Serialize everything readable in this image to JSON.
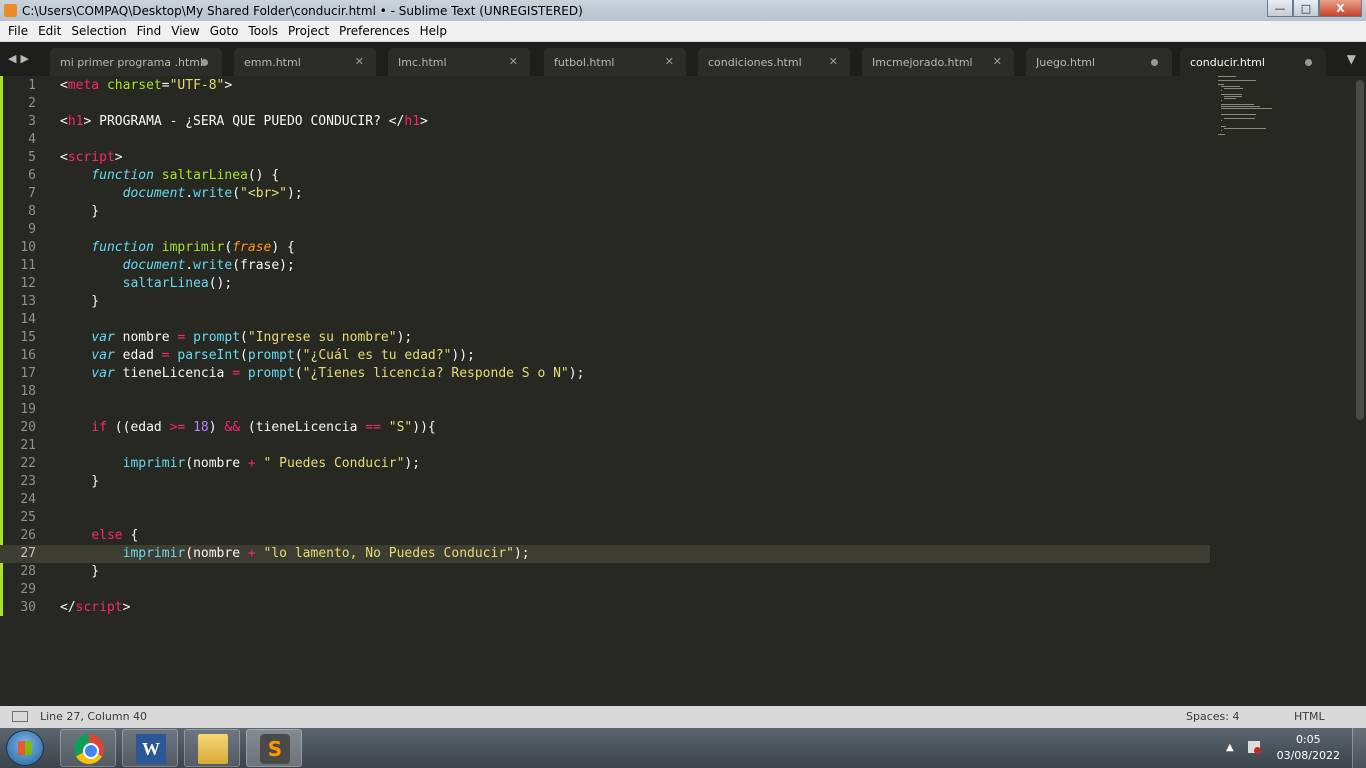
{
  "window": {
    "title": "C:\\Users\\COMPAQ\\Desktop\\My Shared Folder\\conducir.html • - Sublime Text (UNREGISTERED)",
    "minimize": "—",
    "maximize": "□",
    "close": "X"
  },
  "menu": [
    "File",
    "Edit",
    "Selection",
    "Find",
    "View",
    "Goto",
    "Tools",
    "Project",
    "Preferences",
    "Help"
  ],
  "tabs": [
    {
      "label": "mi primer programa .html",
      "state": "modified"
    },
    {
      "label": "emm.html",
      "state": "close"
    },
    {
      "label": "Imc.html",
      "state": "close"
    },
    {
      "label": "futbol.html",
      "state": "close"
    },
    {
      "label": "condiciones.html",
      "state": "close"
    },
    {
      "label": "Imcmejorado.html",
      "state": "close"
    },
    {
      "label": "Juego.html",
      "state": "modified"
    },
    {
      "label": "conducir.html",
      "state": "modified",
      "active": true
    }
  ],
  "editor": {
    "current_line": 27,
    "lines": [
      [
        [
          "w",
          "<"
        ],
        [
          "k",
          "meta"
        ],
        [
          "w",
          " "
        ],
        [
          "a",
          "charset"
        ],
        [
          "w",
          "="
        ],
        [
          "s",
          "\"UTF-8\""
        ],
        [
          "w",
          ">"
        ]
      ],
      [],
      [
        [
          "w",
          "<"
        ],
        [
          "k",
          "h1"
        ],
        [
          "w",
          "> PROGRAMA - ¿SERA QUE PUEDO CONDUCIR? </"
        ],
        [
          "k",
          "h1"
        ],
        [
          "w",
          ">"
        ]
      ],
      [],
      [
        [
          "w",
          "<"
        ],
        [
          "k",
          "script"
        ],
        [
          "w",
          ">"
        ]
      ],
      [
        [
          "w",
          "    "
        ],
        [
          "fi",
          "function"
        ],
        [
          "w",
          " "
        ],
        [
          "a",
          "saltarLinea"
        ],
        [
          "w",
          "() {"
        ]
      ],
      [
        [
          "w",
          "        "
        ],
        [
          "fi",
          "document"
        ],
        [
          "w",
          "."
        ],
        [
          "f",
          "write"
        ],
        [
          "w",
          "("
        ],
        [
          "s",
          "\"<br>\""
        ],
        [
          "w",
          ");"
        ]
      ],
      [
        [
          "w",
          "    }"
        ]
      ],
      [],
      [
        [
          "w",
          "    "
        ],
        [
          "fi",
          "function"
        ],
        [
          "w",
          " "
        ],
        [
          "a",
          "imprimir"
        ],
        [
          "w",
          "("
        ],
        [
          "p",
          "frase"
        ],
        [
          "w",
          ") {"
        ]
      ],
      [
        [
          "w",
          "        "
        ],
        [
          "fi",
          "document"
        ],
        [
          "w",
          "."
        ],
        [
          "f",
          "write"
        ],
        [
          "w",
          "(frase);"
        ]
      ],
      [
        [
          "w",
          "        "
        ],
        [
          "f",
          "saltarLinea"
        ],
        [
          "w",
          "();"
        ]
      ],
      [
        [
          "w",
          "    }"
        ]
      ],
      [],
      [
        [
          "w",
          "    "
        ],
        [
          "fi",
          "var"
        ],
        [
          "w",
          " nombre "
        ],
        [
          "k",
          "="
        ],
        [
          "w",
          " "
        ],
        [
          "f",
          "prompt"
        ],
        [
          "w",
          "("
        ],
        [
          "s",
          "\"Ingrese su nombre\""
        ],
        [
          "w",
          ");"
        ]
      ],
      [
        [
          "w",
          "    "
        ],
        [
          "fi",
          "var"
        ],
        [
          "w",
          " edad "
        ],
        [
          "k",
          "="
        ],
        [
          "w",
          " "
        ],
        [
          "f",
          "parseInt"
        ],
        [
          "w",
          "("
        ],
        [
          "f",
          "prompt"
        ],
        [
          "w",
          "("
        ],
        [
          "s",
          "\"¿Cuál es tu edad?\""
        ],
        [
          "w",
          "));"
        ]
      ],
      [
        [
          "w",
          "    "
        ],
        [
          "fi",
          "var"
        ],
        [
          "w",
          " tieneLicencia "
        ],
        [
          "k",
          "="
        ],
        [
          "w",
          " "
        ],
        [
          "f",
          "prompt"
        ],
        [
          "w",
          "("
        ],
        [
          "s",
          "\"¿Tienes licencia? Responde S o N\""
        ],
        [
          "w",
          ");"
        ]
      ],
      [],
      [],
      [
        [
          "w",
          "    "
        ],
        [
          "k",
          "if"
        ],
        [
          "w",
          " ((edad "
        ],
        [
          "k",
          ">="
        ],
        [
          "w",
          " "
        ],
        [
          "n",
          "18"
        ],
        [
          "w",
          ") "
        ],
        [
          "k",
          "&&"
        ],
        [
          "w",
          " (tieneLicencia "
        ],
        [
          "k",
          "=="
        ],
        [
          "w",
          " "
        ],
        [
          "s",
          "\"S\""
        ],
        [
          "w",
          ")){"
        ]
      ],
      [],
      [
        [
          "w",
          "        "
        ],
        [
          "f",
          "imprimir"
        ],
        [
          "w",
          "(nombre "
        ],
        [
          "k",
          "+"
        ],
        [
          "w",
          " "
        ],
        [
          "s",
          "\" Puedes Conducir\""
        ],
        [
          "w",
          ");"
        ]
      ],
      [
        [
          "w",
          "    }"
        ]
      ],
      [],
      [],
      [
        [
          "w",
          "    "
        ],
        [
          "k",
          "else"
        ],
        [
          "w",
          " {"
        ]
      ],
      [
        [
          "w",
          "        "
        ],
        [
          "f",
          "imprimir"
        ],
        [
          "w",
          "(nombre "
        ],
        [
          "k",
          "+"
        ],
        [
          "w",
          " "
        ],
        [
          "s",
          "\"lo lamento, No Puedes Conducir\""
        ],
        [
          "w",
          ");"
        ]
      ],
      [
        [
          "w",
          "    }"
        ]
      ],
      [],
      [
        [
          "w",
          "</"
        ],
        [
          "k",
          "script"
        ],
        [
          "w",
          ">"
        ]
      ]
    ]
  },
  "status": {
    "position": "Line 27, Column 40",
    "spaces": "Spaces: 4",
    "syntax": "HTML"
  },
  "taskbar": {
    "apps": [
      "chrome-icon",
      "word-icon",
      "file-explorer-icon",
      "sublime-text-icon"
    ],
    "word_letter": "W",
    "sublime_letter": "S",
    "time": "0:05",
    "date": "03/08/2022",
    "tray_arrow": "▲"
  },
  "colors": {
    "background": "#272822",
    "keyword": "#f92672",
    "string": "#e6db74",
    "function": "#a6e22e",
    "builtin": "#66d9ef",
    "parameter": "#fd971f",
    "number": "#ae81ff"
  }
}
